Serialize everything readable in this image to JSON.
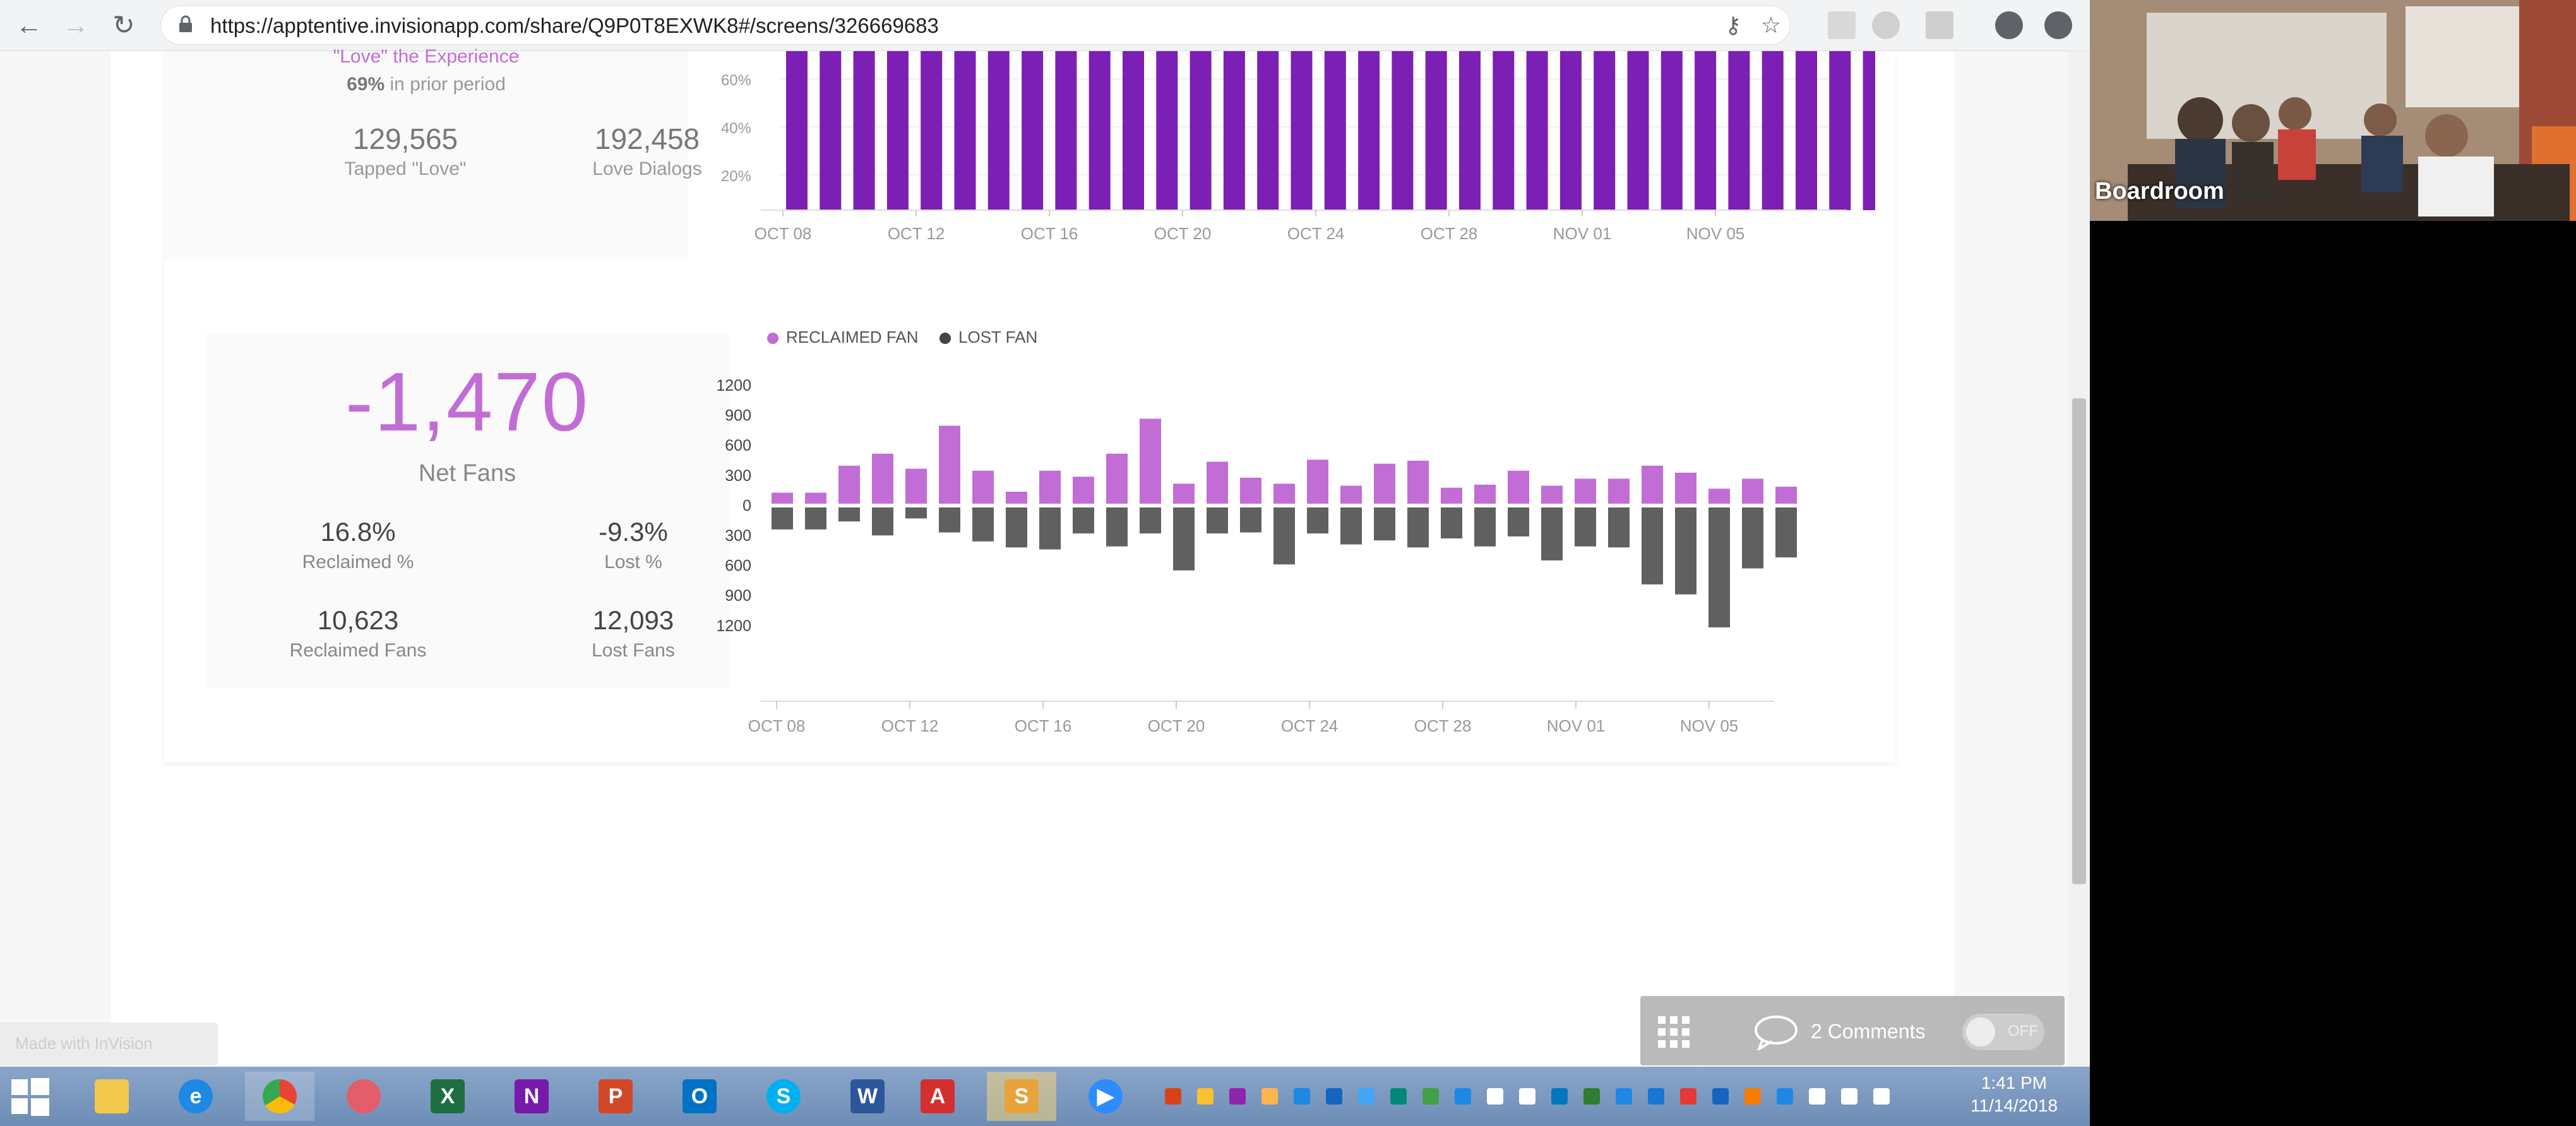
{
  "browser": {
    "url": "https://apptentive.invisionapp.com/share/Q9P0T8EXWK8#/screens/326669683"
  },
  "love_panel": {
    "caption": "\"Love\" the Experience",
    "prior_pct": "69%",
    "prior_text": "in prior period",
    "tapped_love_value": "129,565",
    "tapped_love_label": "Tapped \"Love\"",
    "love_dialogs_value": "192,458",
    "love_dialogs_label": "Love Dialogs"
  },
  "love_chart": {
    "y_ticks": [
      "60%",
      "40%",
      "20%"
    ],
    "x_ticks": [
      "OCT 08",
      "OCT 12",
      "OCT 16",
      "OCT 20",
      "OCT 24",
      "OCT 28",
      "NOV 01",
      "NOV 05"
    ]
  },
  "fans_panel": {
    "net_value": "-1,470",
    "net_label": "Net Fans",
    "reclaimed_pct": "16.8%",
    "reclaimed_pct_label": "Reclaimed %",
    "lost_pct": "-9.3%",
    "lost_pct_label": "Lost %",
    "reclaimed_fans": "10,623",
    "reclaimed_fans_label": "Reclaimed Fans",
    "lost_fans": "12,093",
    "lost_fans_label": "Lost Fans"
  },
  "chart_data": [
    {
      "type": "bar",
      "x_ticks": [
        "OCT 08",
        "OCT 12",
        "OCT 16",
        "OCT 20",
        "OCT 24",
        "OCT 28",
        "NOV 01",
        "NOV 05"
      ],
      "y_ticks": [
        "60%",
        "40%",
        "20%"
      ],
      "values": [
        100,
        100,
        100,
        100,
        100,
        100,
        100,
        100,
        100,
        99,
        99,
        99,
        100,
        99,
        99,
        99,
        100,
        99,
        99,
        99,
        99,
        99,
        100,
        99,
        99,
        100,
        99,
        99,
        100,
        99,
        99,
        100,
        99,
        94,
        89,
        93,
        100
      ],
      "colors": {
        "bar": "#7b1fb5",
        "track": "#ebebeb"
      }
    },
    {
      "type": "bar",
      "legend": [
        "RECLAIMED FAN",
        "LOST FAN"
      ],
      "y_ticks": [
        "1200",
        "900",
        "600",
        "300",
        "0",
        "300",
        "600",
        "900",
        "1200"
      ],
      "x_ticks": [
        "OCT 08",
        "OCT 12",
        "OCT 16",
        "OCT 20",
        "OCT 24",
        "OCT 28",
        "NOV 01",
        "NOV 05"
      ],
      "series": [
        {
          "name": "RECLAIMED FAN",
          "values": [
            110,
            110,
            380,
            500,
            350,
            780,
            330,
            120,
            330,
            270,
            500,
            850,
            200,
            420,
            260,
            200,
            440,
            180,
            400,
            430,
            160,
            190,
            330,
            180,
            250,
            250,
            380,
            310,
            150,
            250,
            170
          ],
          "color": "#c26cd6"
        },
        {
          "name": "LOST FAN",
          "values": [
            -220,
            -220,
            -140,
            -280,
            -110,
            -250,
            -340,
            -400,
            -420,
            -260,
            -390,
            -260,
            -630,
            -260,
            -250,
            -570,
            -260,
            -370,
            -330,
            -400,
            -310,
            -390,
            -290,
            -530,
            -390,
            -400,
            -770,
            -870,
            -1200,
            -610,
            -500
          ],
          "color": "#606060"
        }
      ]
    }
  ],
  "comments": {
    "label": "2 Comments",
    "toggle": "OFF"
  },
  "video": {
    "label": "Boardroom"
  },
  "invision": {
    "label": "Made with InVision"
  },
  "taskbar": {
    "time": "1:41 PM",
    "date": "11/14/2018"
  }
}
